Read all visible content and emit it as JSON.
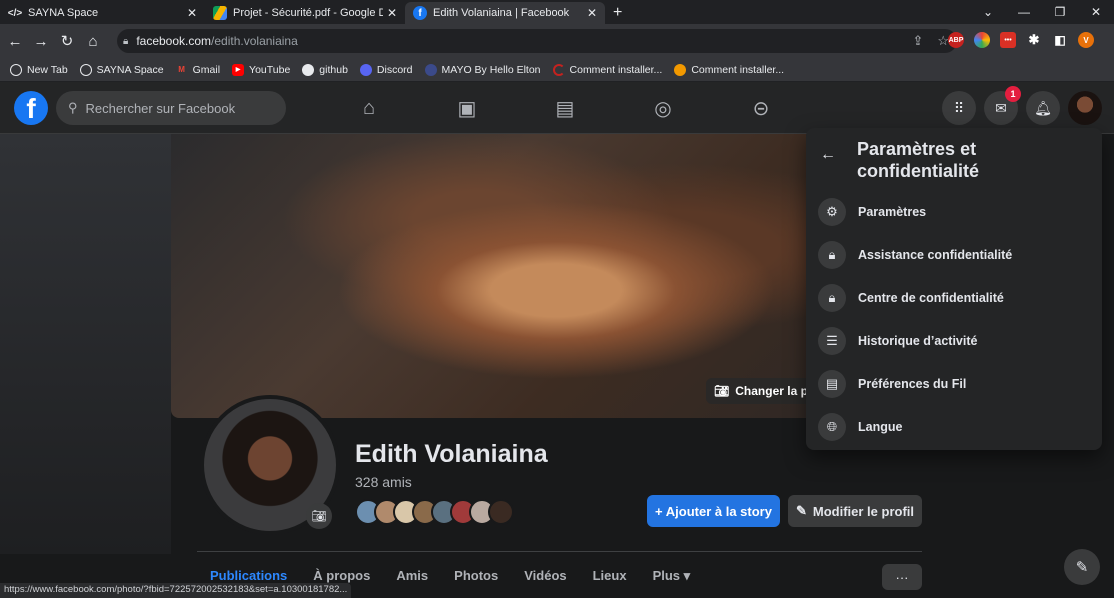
{
  "browser": {
    "tabs": [
      {
        "title": "SAYNA Space",
        "icon": "sayna-icon"
      },
      {
        "title": "Projet - Sécurité.pdf - Google Dr",
        "icon": "google-drive-icon"
      },
      {
        "title": "Edith Volaniaina | Facebook",
        "icon": "facebook-icon"
      }
    ],
    "url_domain": "facebook.com",
    "url_path": "/edith.volaniaina",
    "bookmarks": [
      "New Tab",
      "SAYNA Space",
      "Gmail",
      "YouTube",
      "github",
      "Discord",
      "MAYO By Hello Elton",
      "Comment installer...",
      "Comment installer..."
    ],
    "status_url": "https://www.facebook.com/photo/?fbid=722572002532183&set=a.10300181782..."
  },
  "fb": {
    "search_placeholder": "Rechercher sur Facebook",
    "messenger_badge": "1"
  },
  "profile": {
    "name": "Edith Volaniaina",
    "friends": "328 amis",
    "change_cover": "Changer la photo de couverture",
    "add_story": "+ Ajouter à la story",
    "edit_profile": "Modifier le profil",
    "tabs": [
      "Publications",
      "À propos",
      "Amis",
      "Photos",
      "Vidéos",
      "Lieux",
      "Plus ▾"
    ],
    "more": "···"
  },
  "menu": {
    "title": "Paramètres et confidentialité",
    "items": [
      {
        "label": "Paramètres",
        "icon": "gear-icon"
      },
      {
        "label": "Assistance confidentialité",
        "icon": "lock-star-icon"
      },
      {
        "label": "Centre de confidentialité",
        "icon": "lock-icon"
      },
      {
        "label": "Historique d’activité",
        "icon": "list-icon"
      },
      {
        "label": "Préférences du Fil",
        "icon": "feed-icon"
      },
      {
        "label": "Langue",
        "icon": "globe-icon"
      }
    ]
  },
  "colors": {
    "fb_blue": "#1877f2",
    "accent_blue": "#2374e1",
    "badge_red": "#e41e3f",
    "bg_dark": "#18191a",
    "surface": "#242526"
  }
}
